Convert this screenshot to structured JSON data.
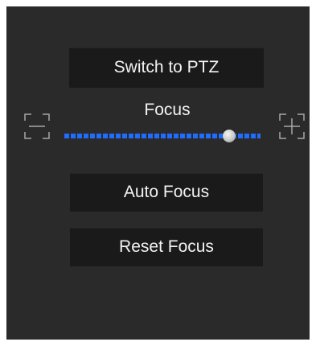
{
  "ptz_panel": {
    "switch_button_label": "Switch to PTZ",
    "focus": {
      "label": "Focus",
      "value_fraction": 0.84,
      "decrease_icon": "focus-minus-icon",
      "increase_icon": "focus-plus-icon",
      "track_color": "#1f6cff"
    },
    "auto_focus_label": "Auto Focus",
    "reset_focus_label": "Reset Focus"
  },
  "colors": {
    "panel_background": "#2a2a2a",
    "button_background": "#1a1a1a",
    "text": "#f2f2f2",
    "icon_stroke": "#a8a8a8"
  }
}
